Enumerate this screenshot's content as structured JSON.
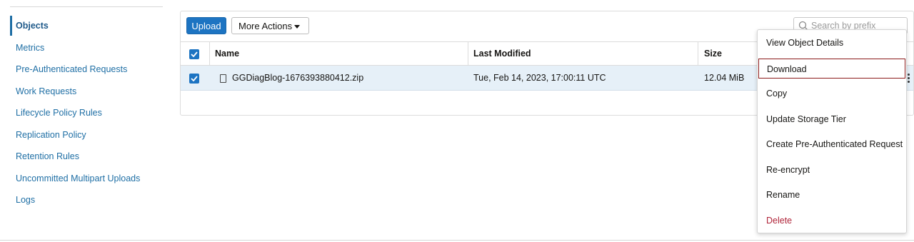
{
  "sidebar": {
    "items": [
      {
        "label": "Objects",
        "active": true
      },
      {
        "label": "Metrics"
      },
      {
        "label": "Pre-Authenticated Requests"
      },
      {
        "label": "Work Requests"
      },
      {
        "label": "Lifecycle Policy Rules"
      },
      {
        "label": "Replication Policy"
      },
      {
        "label": "Retention Rules"
      },
      {
        "label": "Uncommitted Multipart Uploads"
      },
      {
        "label": "Logs"
      }
    ]
  },
  "toolbar": {
    "upload_label": "Upload",
    "more_actions_label": "More Actions",
    "search_placeholder": "Search by prefix"
  },
  "table": {
    "columns": [
      "Name",
      "Last Modified",
      "Size"
    ],
    "rows": [
      {
        "checked": true,
        "name": "GGDiagBlog-1676393880412.zip",
        "last_modified": "Tue, Feb 14, 2023, 17:00:11 UTC",
        "size": "12.04 MiB"
      }
    ]
  },
  "context_menu": {
    "items": [
      {
        "label": "View Object Details"
      },
      {
        "label": "Download",
        "focused": true
      },
      {
        "label": "Copy"
      },
      {
        "label": "Update Storage Tier"
      },
      {
        "label": "Create Pre-Authenticated Request"
      },
      {
        "label": "Re-encrypt"
      },
      {
        "label": "Rename"
      },
      {
        "label": "Delete",
        "danger": true
      }
    ]
  },
  "colors": {
    "primary": "#1d74c2",
    "link": "#1f6fa5",
    "selected_row": "#e6f0f8",
    "danger": "#b0253a",
    "focus_outline": "#8b1a1a"
  }
}
